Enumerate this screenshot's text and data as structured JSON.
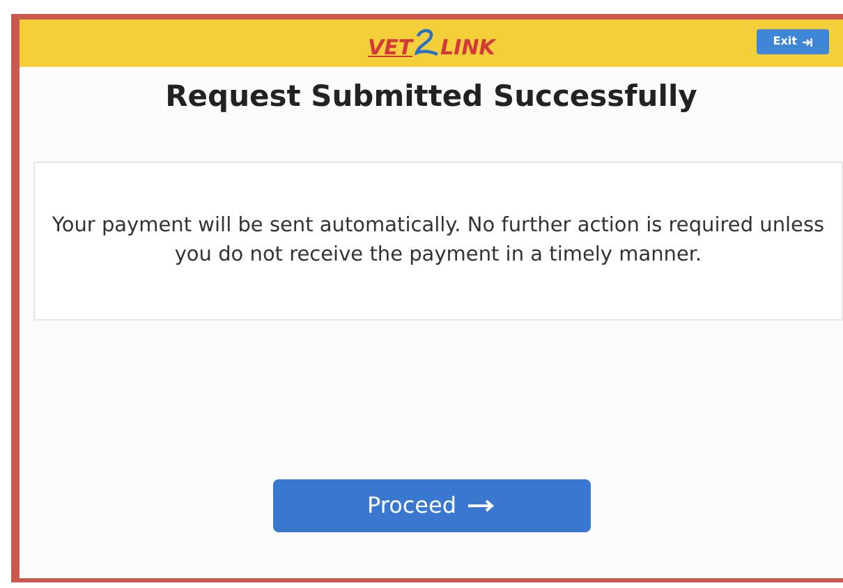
{
  "header": {
    "logo": {
      "left": "VET",
      "right": "LINK"
    },
    "exit_button": {
      "label": "Exit"
    }
  },
  "title": "Request Submitted Successfully",
  "message": "Your payment will be sent automatically. No further action is required unless you do not receive the payment in a timely manner.",
  "proceed_button": {
    "label": "Proceed"
  }
}
